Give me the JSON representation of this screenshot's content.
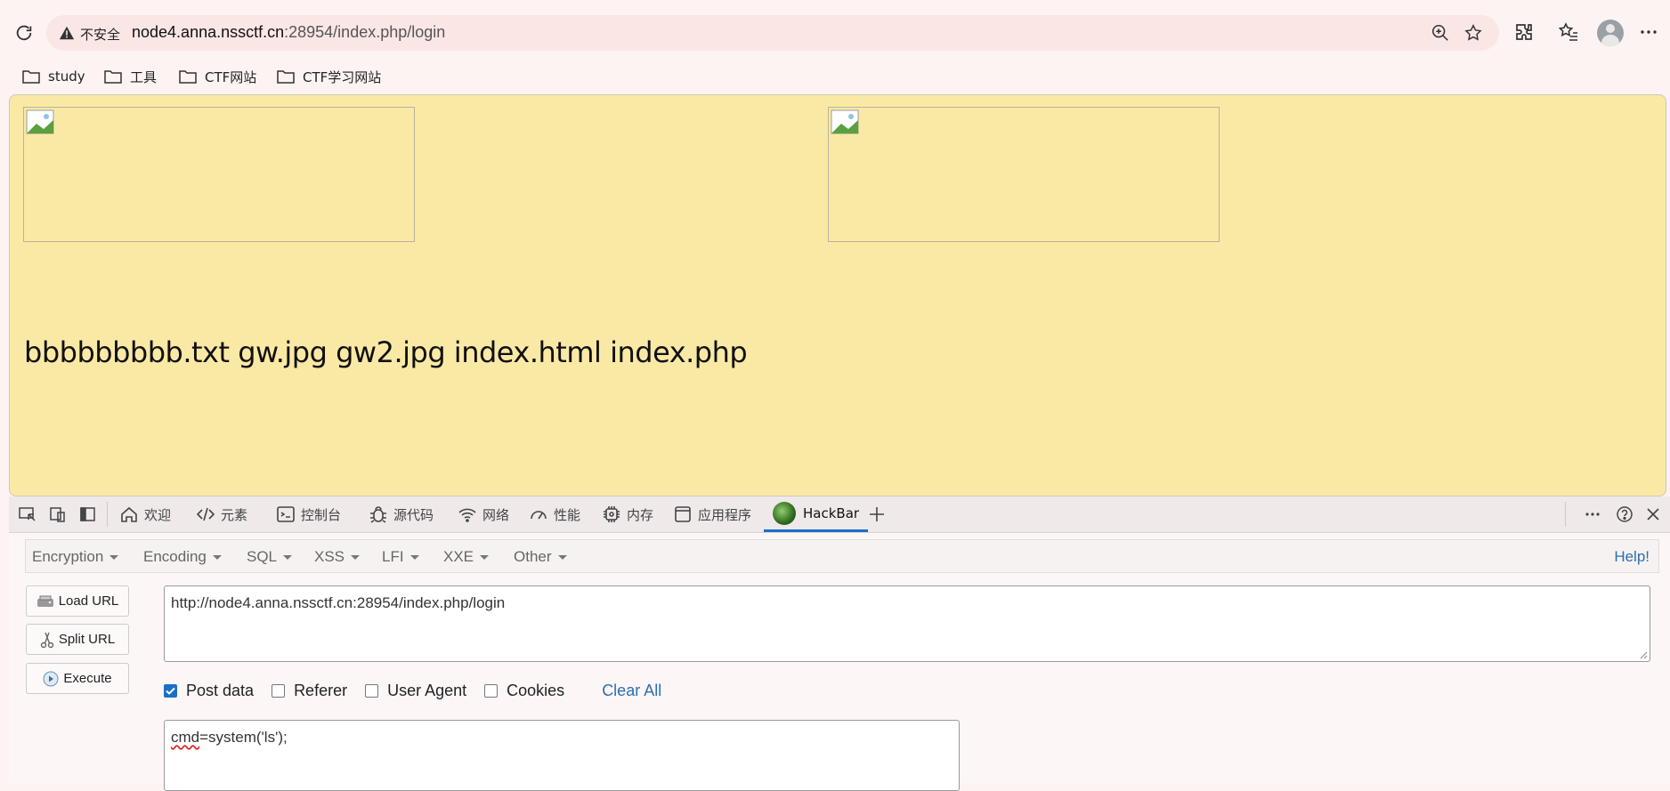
{
  "browser": {
    "security_label": "不安全",
    "url_host": "node4.anna.nssctf.cn",
    "url_rest": ":28954/index.php/login"
  },
  "bookmarks": [
    {
      "label": "study",
      "icon": "folder-icon"
    },
    {
      "label": "工具",
      "icon": "folder-icon"
    },
    {
      "label": "CTF网站",
      "icon": "folder-icon"
    },
    {
      "label": "CTF学习网站",
      "icon": "folder-icon"
    }
  ],
  "page": {
    "listing": "bbbbbbbbb.txt gw.jpg gw2.jpg index.html index.php",
    "images": [
      "broken-image-icon",
      "broken-image-icon"
    ],
    "background": "#fae9a5"
  },
  "devtools": {
    "tabs": [
      {
        "label": "欢迎",
        "icon": "home-icon"
      },
      {
        "label": "元素",
        "icon": "code-icon"
      },
      {
        "label": "控制台",
        "icon": "console-icon"
      },
      {
        "label": "源代码",
        "icon": "bug-icon"
      },
      {
        "label": "网络",
        "icon": "wifi-icon"
      },
      {
        "label": "性能",
        "icon": "gauge-icon"
      },
      {
        "label": "内存",
        "icon": "chip-icon"
      },
      {
        "label": "应用程序",
        "icon": "window-icon"
      },
      {
        "label": "HackBar",
        "icon": "hackbar-logo-icon",
        "active": true
      }
    ],
    "accent": "#1a6fc9"
  },
  "hackbar": {
    "menu": [
      "Encryption",
      "Encoding",
      "SQL",
      "XSS",
      "LFI",
      "XXE",
      "Other"
    ],
    "help": "Help!",
    "buttons": {
      "load": "Load URL",
      "split": "Split URL",
      "execute": "Execute"
    },
    "url_value": "http://node4.anna.nssctf.cn:28954/index.php/login",
    "options": [
      {
        "label": "Post data",
        "checked": true
      },
      {
        "label": "Referer",
        "checked": false
      },
      {
        "label": "User Agent",
        "checked": false
      },
      {
        "label": "Cookies",
        "checked": false
      }
    ],
    "clear_all": "Clear All",
    "post_value_prefix": "cmd",
    "post_value_rest": "=system('ls');"
  }
}
